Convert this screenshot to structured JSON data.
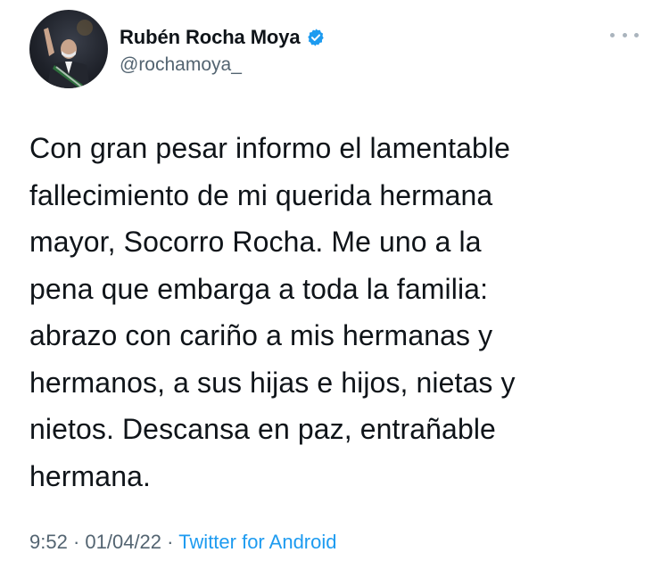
{
  "author": {
    "display_name": "Rubén Rocha Moya",
    "handle": "@rochamoya_",
    "verified": true,
    "avatar_icon": "profile-photo-avatar"
  },
  "tweet": {
    "text": "Con gran pesar informo el lamentable\nfallecimiento de mi querida hermana\nmayor, Socorro Rocha. Me uno a la\npena que embarga a toda la familia:\nabrazo con cariño a mis hermanas y\nhermanos, a sus hijas e hijos, nietas y\nnietos. Descansa en paz, entrañable\nhermana.",
    "time": "9:52",
    "separator": " · ",
    "date": "01/04/22",
    "source": "Twitter for Android"
  },
  "icons": {
    "more": "more-horizontal-icon",
    "verified": "verified-badge-icon"
  },
  "colors": {
    "text": "#0f1419",
    "secondary": "#536471",
    "accent": "#1d9bf0"
  }
}
